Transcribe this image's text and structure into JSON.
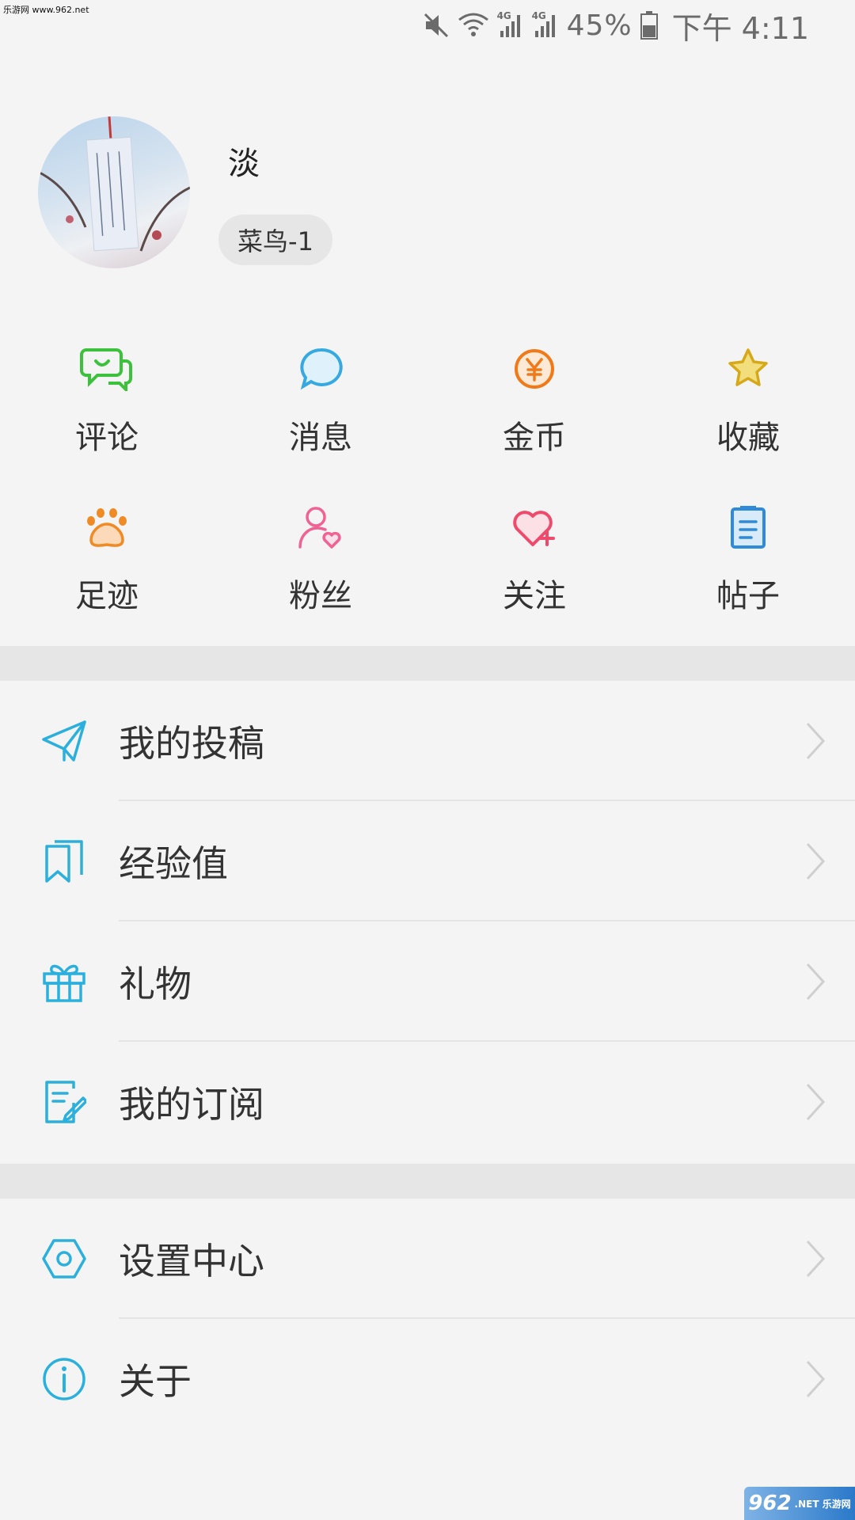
{
  "watermark_top": "乐游网 www.962.net",
  "status_bar": {
    "network_tag_1": "4G",
    "network_tag_2": "4G",
    "battery": "45%",
    "time": "下午 4:11"
  },
  "profile": {
    "username": "淡",
    "level": "菜鸟-1"
  },
  "quick_actions": [
    {
      "label": "评论",
      "icon": "comment-icon",
      "color": "#3cc13c"
    },
    {
      "label": "消息",
      "icon": "message-icon",
      "color": "#36a9e1"
    },
    {
      "label": "金币",
      "icon": "coin-icon",
      "color": "#f07a1a"
    },
    {
      "label": "收藏",
      "icon": "star-icon",
      "color": "#e0b81c"
    },
    {
      "label": "足迹",
      "icon": "paw-icon",
      "color": "#f08a24"
    },
    {
      "label": "粉丝",
      "icon": "fans-icon",
      "color": "#f06292"
    },
    {
      "label": "关注",
      "icon": "follow-heart-icon",
      "color": "#ef4a6b"
    },
    {
      "label": "帖子",
      "icon": "posts-icon",
      "color": "#2f8ad8"
    }
  ],
  "menu_group_1": [
    {
      "label": "我的投稿",
      "icon": "send-icon"
    },
    {
      "label": "经验值",
      "icon": "bookmark-icon"
    },
    {
      "label": "礼物",
      "icon": "gift-icon"
    },
    {
      "label": "我的订阅",
      "icon": "edit-note-icon"
    }
  ],
  "menu_group_2": [
    {
      "label": "设置中心",
      "icon": "settings-hexagon-icon"
    },
    {
      "label": "关于",
      "icon": "info-icon"
    }
  ],
  "accent_color": "#2bb0dd",
  "watermark_bottom": {
    "brand": "962",
    "suffix": ".NET 乐游网"
  }
}
